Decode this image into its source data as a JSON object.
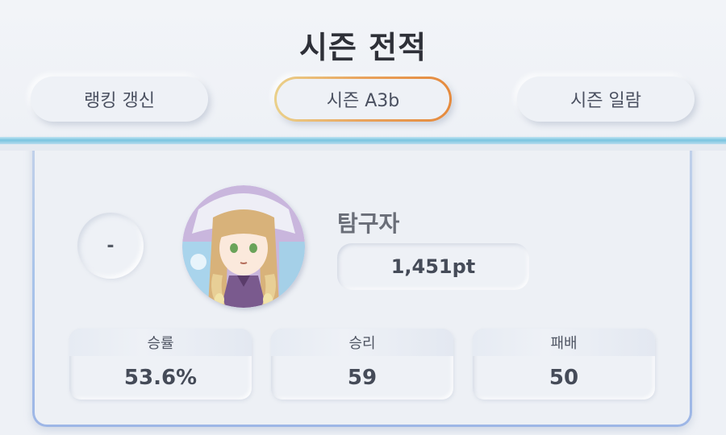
{
  "header": {
    "title": "시즌 전적",
    "tabs": {
      "left": "랭킹 갱신",
      "center": "시즌 A3b",
      "right": "시즌 일람"
    }
  },
  "player": {
    "rank": "-",
    "name": "탐구자",
    "points": "1,451pt",
    "avatar_icon": "character-portrait"
  },
  "stats": [
    {
      "label": "승률",
      "value": "53.6%"
    },
    {
      "label": "승리",
      "value": "59"
    },
    {
      "label": "패배",
      "value": "50"
    }
  ],
  "colors": {
    "accent_gold": "#e9a35d",
    "header_bar": "#79c4e0",
    "card_border": "#a9c4ea"
  }
}
